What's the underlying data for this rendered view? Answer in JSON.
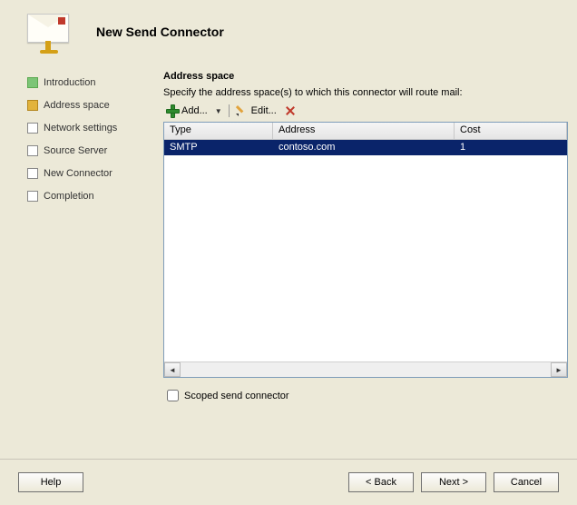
{
  "header": {
    "title": "New Send Connector"
  },
  "nav": {
    "items": [
      {
        "label": "Introduction",
        "state": "done"
      },
      {
        "label": "Address space",
        "state": "current"
      },
      {
        "label": "Network settings",
        "state": "pending"
      },
      {
        "label": "Source Server",
        "state": "pending"
      },
      {
        "label": "New Connector",
        "state": "pending"
      },
      {
        "label": "Completion",
        "state": "pending"
      }
    ]
  },
  "page": {
    "heading": "Address space",
    "instruction": "Specify the address space(s) to which this connector will route mail:"
  },
  "toolbar": {
    "add_label": "Add...",
    "edit_label": "Edit..."
  },
  "table": {
    "columns": {
      "type": "Type",
      "address": "Address",
      "cost": "Cost"
    },
    "rows": [
      {
        "type": "SMTP",
        "address": "contoso.com",
        "cost": "1",
        "selected": true
      }
    ]
  },
  "scoped": {
    "label": "Scoped send connector",
    "checked": false
  },
  "buttons": {
    "help": "Help",
    "back": "< Back",
    "next": "Next >",
    "cancel": "Cancel"
  }
}
